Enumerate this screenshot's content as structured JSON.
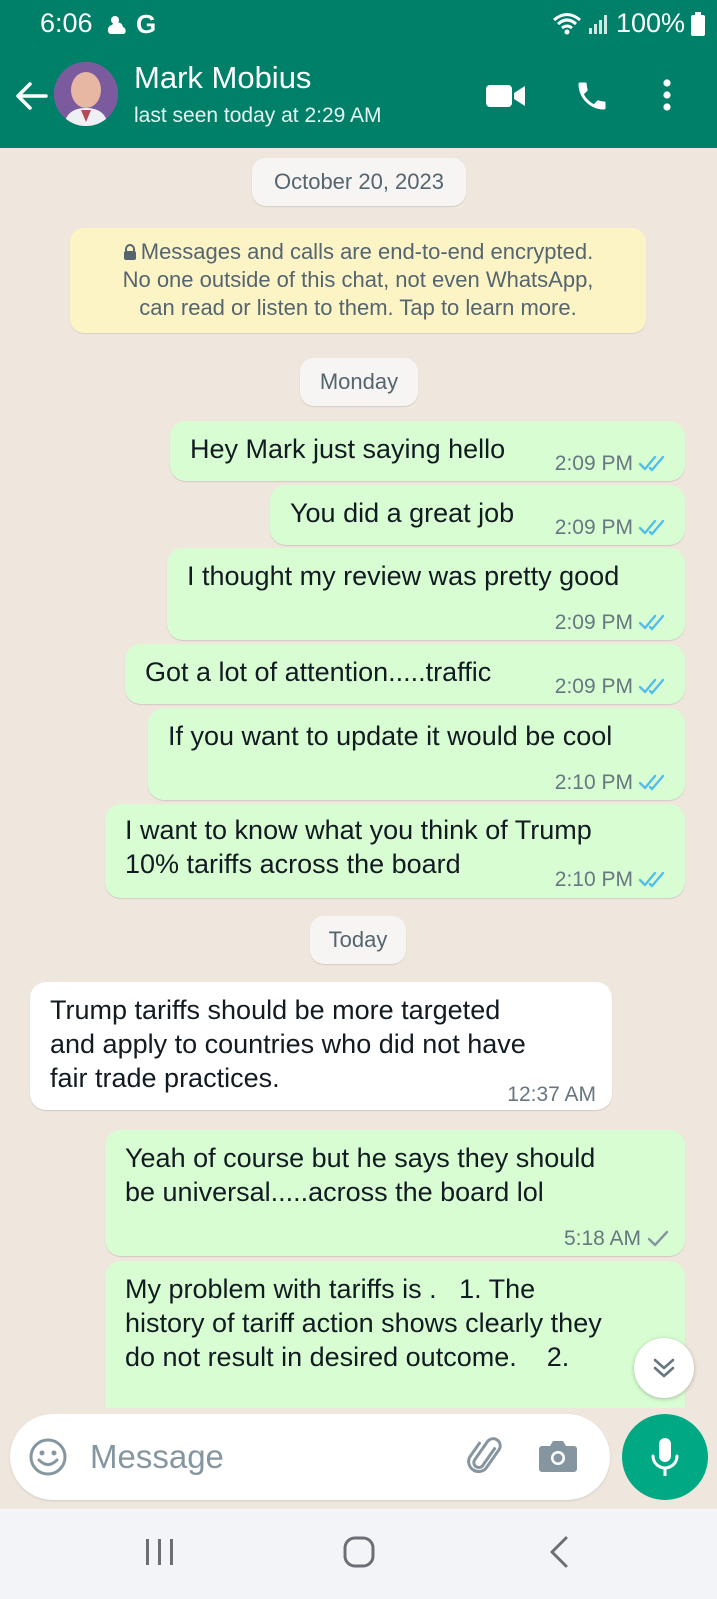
{
  "status_bar": {
    "time": "6:06",
    "carrier_icon": "G",
    "battery": "100%"
  },
  "header": {
    "contact_name": "Mark Mobius",
    "last_seen": "last seen today at 2:29 AM"
  },
  "chat": {
    "date_pill": "October 20, 2023",
    "encryption_notice": [
      "Messages and calls are end-to-end encrypted.",
      "No one outside of this chat, not even WhatsApp,",
      "can read or listen to them. Tap to learn more."
    ],
    "day_monday": "Monday",
    "day_today": "Today",
    "messages": [
      {
        "text": "Hey Mark just saying hello",
        "time": "2:09 PM"
      },
      {
        "text": "You did a great job",
        "time": "2:09 PM"
      },
      {
        "text": "I thought my review was pretty good",
        "time": "2:09 PM"
      },
      {
        "text": "Got a lot of attention.....traffic",
        "time": "2:09 PM"
      },
      {
        "text": "If you want to update it would be cool",
        "time": "2:10 PM"
      },
      {
        "lines": [
          "I want to know what you think of Trump",
          "10% tariffs across the board"
        ],
        "time": "2:10 PM"
      },
      {
        "lines": [
          "Trump tariffs should be more targeted",
          "and apply to countries who did not have",
          "fair trade practices."
        ],
        "time": "12:37 AM"
      },
      {
        "lines": [
          "Yeah of course but he says they should",
          "be universal.....across the board lol"
        ],
        "time": "5:18 AM"
      },
      {
        "lines": [
          "My problem with tariffs is .   1. The",
          "history of tariff action shows clearly they",
          "do not result in desired outcome.    2."
        ]
      }
    ]
  },
  "composer": {
    "placeholder": "Message"
  },
  "colors": {
    "header": "#008069",
    "outgoing": "#d9fdd3",
    "incoming": "#ffffff",
    "read_tick": "#53bdeb",
    "mic": "#00a884"
  }
}
